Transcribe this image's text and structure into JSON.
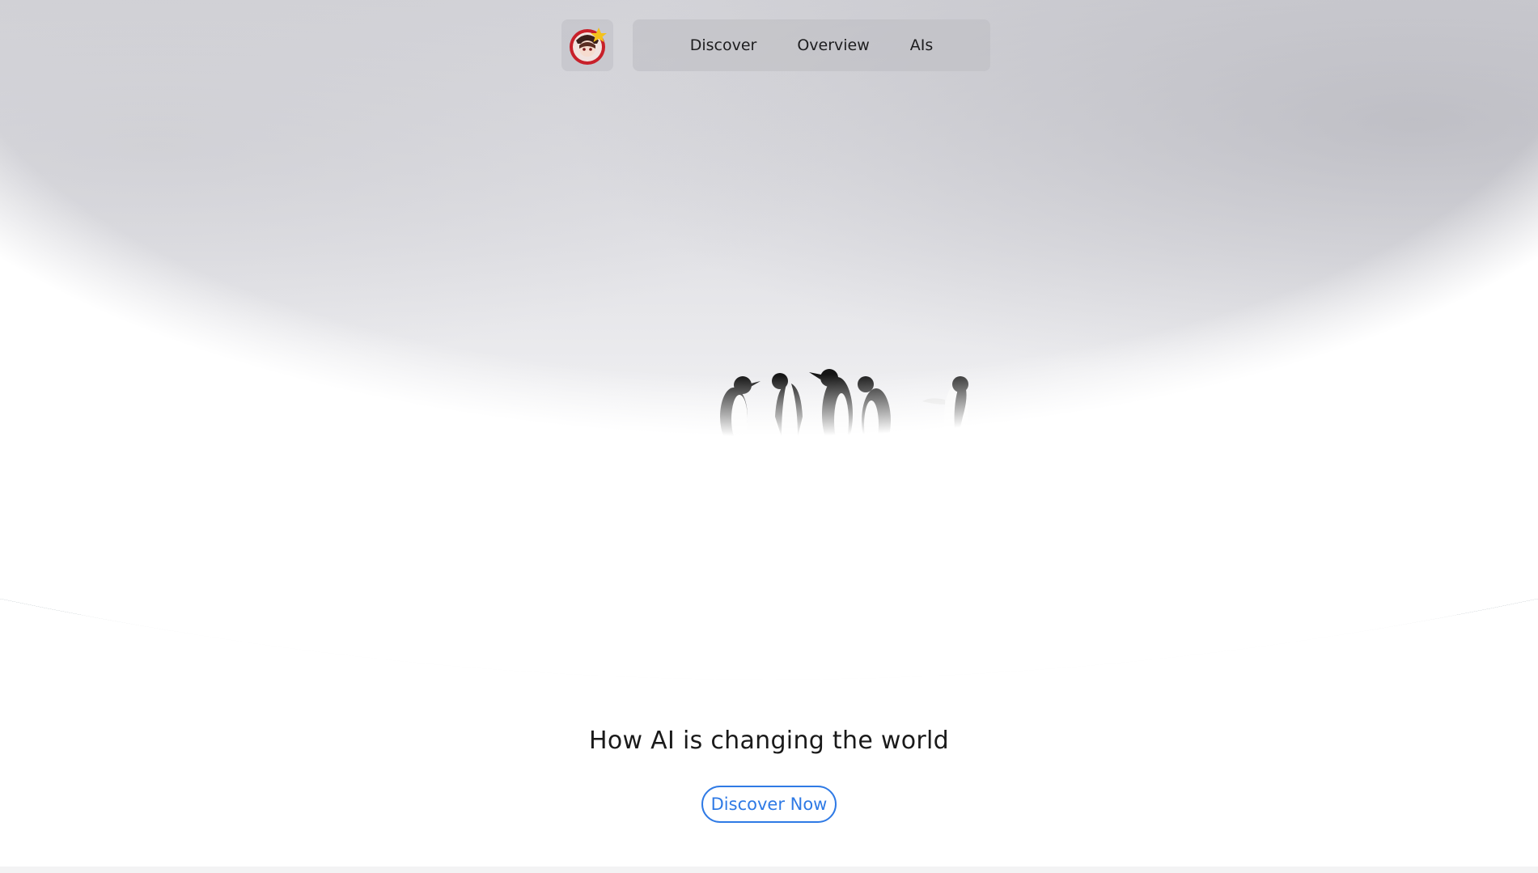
{
  "nav": {
    "logo_alt": "site-logo",
    "links": [
      {
        "label": "Discover"
      },
      {
        "label": "Overview"
      },
      {
        "label": "AIs"
      }
    ]
  },
  "hero": {
    "headline": "How AI is changing the world",
    "cta_label": "Discover Now"
  },
  "colors": {
    "accent": "#2f7ae5",
    "nav_bg": "#bebec4",
    "text": "#1a1a1a"
  }
}
